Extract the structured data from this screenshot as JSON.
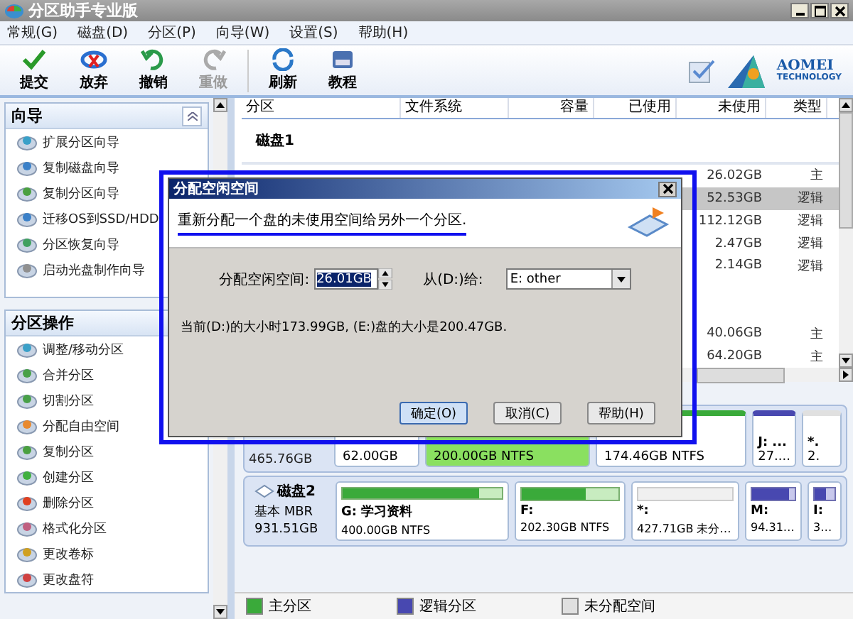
{
  "window": {
    "title": "分区助手专业版"
  },
  "menu": [
    "常规(G)",
    "磁盘(D)",
    "分区(P)",
    "向导(W)",
    "设置(S)",
    "帮助(H)"
  ],
  "toolbar": [
    {
      "label": "提交",
      "kind": "commit",
      "disabled": false
    },
    {
      "label": "放弃",
      "kind": "discard",
      "disabled": false
    },
    {
      "label": "撤销",
      "kind": "undo",
      "disabled": false
    },
    {
      "label": "重做",
      "kind": "redo",
      "disabled": true
    },
    {
      "label": "刷新",
      "kind": "refresh",
      "disabled": false,
      "separator_before": true
    },
    {
      "label": "教程",
      "kind": "tutorial",
      "disabled": false
    }
  ],
  "logo": {
    "brand": "AOMEI",
    "sub": "TECHNOLOGY"
  },
  "sidebar": [
    {
      "title": "向导",
      "items": [
        {
          "label": "扩展分区向导",
          "kind": "extend"
        },
        {
          "label": "复制磁盘向导",
          "kind": "disk"
        },
        {
          "label": "复制分区向导",
          "kind": "copy"
        },
        {
          "label": "迁移OS到SSD/HDD",
          "kind": "disk"
        },
        {
          "label": "分区恢复向导",
          "kind": "recover"
        },
        {
          "label": "启动光盘制作向导",
          "kind": "cd"
        }
      ]
    },
    {
      "title": "分区操作",
      "items": [
        {
          "label": "调整/移动分区",
          "kind": "extend"
        },
        {
          "label": "合并分区",
          "kind": "merge"
        },
        {
          "label": "切割分区",
          "kind": "merge"
        },
        {
          "label": "分配自由空间",
          "kind": "allocate"
        },
        {
          "label": "复制分区",
          "kind": "copy"
        },
        {
          "label": "创建分区",
          "kind": "create"
        },
        {
          "label": "删除分区",
          "kind": "delete"
        },
        {
          "label": "格式化分区",
          "kind": "format"
        },
        {
          "label": "更改卷标",
          "kind": "label"
        },
        {
          "label": "更改盘符",
          "kind": "letter"
        }
      ]
    }
  ],
  "table": {
    "columns": [
      "分区",
      "文件系统",
      "容量",
      "已使用",
      "未使用",
      "类型"
    ],
    "group": "磁盘1",
    "rows": [
      {
        "unused": "26.02GB",
        "type": "主",
        "selected": false
      },
      {
        "unused": "52.53GB",
        "type": "逻辑",
        "selected": true
      },
      {
        "unused": "112.12GB",
        "type": "逻辑",
        "selected": false
      },
      {
        "unused": "2.47GB",
        "type": "逻辑",
        "selected": false
      },
      {
        "unused": "2.14GB",
        "type": "逻辑",
        "selected": false
      },
      {
        "unused": "",
        "type": "",
        "selected": false
      },
      {
        "unused": "",
        "type": "",
        "selected": false
      },
      {
        "unused": "40.06GB",
        "type": "主",
        "selected": false
      },
      {
        "unused": "64.20GB",
        "type": "主",
        "selected": false
      }
    ]
  },
  "disk1": {
    "size": "465.76GB",
    "partitions": [
      {
        "info": "62.00GB",
        "kind": "primary",
        "selected": false
      },
      {
        "info": "200.00GB NTFS",
        "kind": "primary",
        "selected": true
      },
      {
        "info": "174.46GB NTFS",
        "kind": "primary",
        "selected": false
      },
      {
        "name": "J: ...",
        "info": "27....",
        "kind": "logical",
        "selected": false
      },
      {
        "name": "*.",
        "info": "2.",
        "kind": "unallocated",
        "selected": false
      }
    ]
  },
  "disk2": {
    "name": "磁盘2",
    "type": "基本 MBR",
    "size": "931.51GB",
    "partitions": [
      {
        "name": "G: 学习资料",
        "info": "400.00GB NTFS",
        "kind": "primary",
        "level": 0.86
      },
      {
        "name": "F:",
        "info": "202.30GB NTFS",
        "kind": "primary",
        "level": 0.66
      },
      {
        "name": "*:",
        "info": "427.71GB 未分…",
        "kind": "unallocated"
      },
      {
        "name": "M:",
        "info": "94.31…",
        "kind": "logical",
        "level": 0.85
      },
      {
        "name": "I:",
        "info": "3…",
        "kind": "logical",
        "level": 0.55
      }
    ]
  },
  "legend": [
    {
      "label": "主分区",
      "kind": "primary"
    },
    {
      "label": "逻辑分区",
      "kind": "logical"
    },
    {
      "label": "未分配空间",
      "kind": "unallocated"
    }
  ],
  "dialog": {
    "title": "分配空闲空间",
    "description": "重新分配一个盘的未使用空间给另外一个分区.",
    "size_label": "分配空闲空间:",
    "size_value": "26.01GB",
    "from_label": "从(D:)给:",
    "target": "E: other",
    "info": "当前(D:)的大小时173.99GB, (E:)盘的大小是200.47GB.",
    "buttons": [
      {
        "label": "确定(O)",
        "selected": true
      },
      {
        "label": "取消(C)",
        "selected": false
      },
      {
        "label": "帮助(H)",
        "selected": false
      }
    ]
  }
}
